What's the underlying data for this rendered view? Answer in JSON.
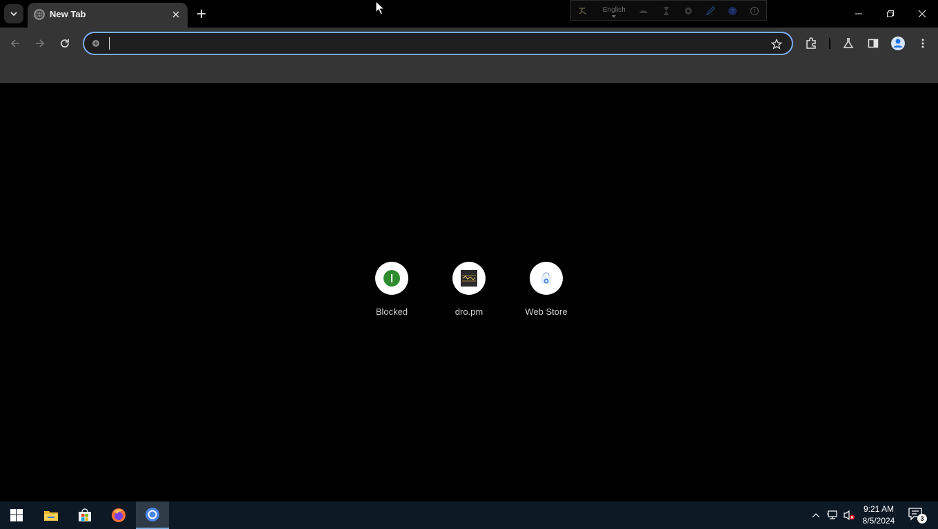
{
  "browser": {
    "active_tab": {
      "title": "New Tab"
    },
    "omnibox": {
      "value": "",
      "placeholder": ""
    },
    "accent_color": "#7cacf8",
    "toolbar_color": "#353535"
  },
  "ime_bar": {
    "language": "English"
  },
  "new_tab_page": {
    "shortcuts": [
      {
        "label": "Blocked",
        "icon": "blocked-green-icon"
      },
      {
        "label": "dro.pm",
        "icon": "dro-pm-site-icon"
      },
      {
        "label": "Web Store",
        "icon": "web-store-icon"
      }
    ]
  },
  "taskbar": {
    "apps": [
      "start-windows-icon",
      "file-explorer-icon",
      "microsoft-store-icon",
      "firefox-icon",
      "chrome-icon"
    ],
    "clock": {
      "time": "9:21 AM",
      "date": "8/5/2024"
    },
    "notification_count": "3"
  }
}
